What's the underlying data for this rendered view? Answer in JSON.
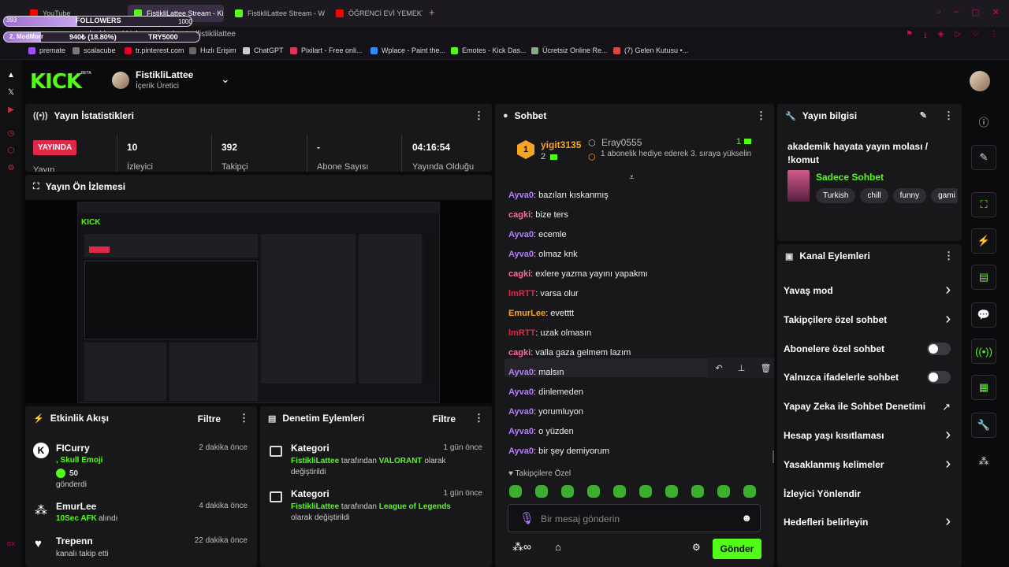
{
  "browser": {
    "tabs": [
      {
        "label": "YouTube",
        "color": "#ff0000"
      },
      {
        "label": "FistikliLattee Stream - Ki",
        "color": "#53fc18"
      },
      {
        "label": "FistikliLattee Stream - Wi",
        "color": "#53fc18"
      },
      {
        "label": "ÖĞRENCİ EVİ YEMEKTE",
        "color": "#ff0000"
      }
    ],
    "new_tab": "+",
    "url": "dashboard.kick.com/moderator/fistiklilattee",
    "bookmarks": [
      "premate",
      "scalacube",
      "tr.pinterest.com",
      "Hızlı Erişim",
      "ChatGPT",
      "Pixilart - Free onli...",
      "Wplace - Paint the...",
      "Emotes - Kick Das...",
      "Ücretsiz Online Re...",
      "(7) Gelen Kutusu •..."
    ]
  },
  "overlay": {
    "followers_count": "393",
    "followers_label": "FOLLOWERS",
    "followers_goal": "1000",
    "line2": "2. ModMorr",
    "money": "940₺ (18.80%)",
    "money_goal": "TRY5000"
  },
  "header": {
    "logo": "KICK",
    "logo_beta": "BETA",
    "channel_name": "FistikliLattee",
    "channel_role": "İçerik Üretici"
  },
  "stats": {
    "title": "Yayın İstatistikleri",
    "live_badge": "YAYINDA",
    "cols": [
      {
        "value": "10",
        "label": "İzleyici"
      },
      {
        "value": "392",
        "label": "Takipçi"
      },
      {
        "value": "-",
        "label": "Abone Sayısı"
      },
      {
        "value": "04:16:54",
        "label": "Yayında Olduğu"
      }
    ],
    "first_label": "Yayın"
  },
  "preview": {
    "title": "Yayın Ön İzlemesi"
  },
  "activity": {
    "title": "Etkinlik Akışı",
    "filter": "Filtre",
    "items": [
      {
        "user": "FICurry",
        "detail1": ", Skull Emoji",
        "amount": "50",
        "detail2": "gönderdi",
        "time": "2 dakika önce"
      },
      {
        "user": "EmurLee",
        "detail1": "10Sec AFK",
        "detail2": "alındı",
        "time": "4 dakika önce"
      },
      {
        "user": "Trepenn",
        "detail2": "kanalı takip etti",
        "time": "22 dakika önce"
      }
    ]
  },
  "moderation": {
    "title": "Denetim Eylemleri",
    "filter": "Filtre",
    "items": [
      {
        "title": "Kategori",
        "user": "FistikliLattee",
        "mid": " tarafından ",
        "cat": "VALORANT",
        "end": " olarak",
        "end2": "değiştirildi",
        "time": "1 gün önce"
      },
      {
        "title": "Kategori",
        "user": "FistikliLattee",
        "mid": " tarafından ",
        "cat": "League of Legends",
        "end": "",
        "end2": "olarak değiştirildi",
        "time": "1 gün önce"
      }
    ]
  },
  "chat": {
    "title": "Sohbet",
    "gifter_rank": "1",
    "gifter_name": "yigit3135",
    "gifter_count": "2",
    "sub_name": "Eray0555",
    "sub_count": "1",
    "sub_text": "1 abonelik hediye ederek 3. sıraya yükselin",
    "messages": [
      {
        "user": "Ayva0",
        "text": "bazıları kıskanmış",
        "color": "#b57cff"
      },
      {
        "user": "cagki",
        "text": "bize ters",
        "color": "#ff6b9a"
      },
      {
        "user": "Ayva0",
        "text": "ecemle",
        "color": "#b57cff"
      },
      {
        "user": "Ayva0",
        "text": "olmaz knk",
        "color": "#b57cff"
      },
      {
        "user": "cagki",
        "text": "exlere yazma yayını yapakmı",
        "color": "#ff6b9a"
      },
      {
        "user": "lmRTT",
        "text": "varsa olur",
        "color": "#e02849"
      },
      {
        "user": "EmurLee",
        "text": "evetttt",
        "color": "#f5a524"
      },
      {
        "user": "lmRTT",
        "text": "uzak olmasın",
        "color": "#e02849"
      },
      {
        "user": "cagki",
        "text": "valla gaza gelmem lazım",
        "color": "#ff6b9a"
      },
      {
        "user": "Ayva0",
        "text": "malsın",
        "color": "#b57cff"
      },
      {
        "user": "Ayva0",
        "text": "dinlemeden",
        "color": "#b57cff"
      },
      {
        "user": "Ayva0",
        "text": "yorumluyon",
        "color": "#b57cff"
      },
      {
        "user": "Ayva0",
        "text": "o yüzden",
        "color": "#b57cff"
      },
      {
        "user": "Ayva0",
        "text": "bir şey demiyorum",
        "color": "#b57cff"
      }
    ],
    "follower_only": "Takipçilere Özel",
    "placeholder": "Bir mesaj gönderin",
    "send": "Gönder"
  },
  "info": {
    "title": "Yayın bilgisi",
    "stream_title": "akademik hayata yayın molası / !komut",
    "category": "Sadece Sohbet",
    "tags": [
      "Turkish",
      "chill",
      "funny",
      "gami"
    ]
  },
  "channel_actions": {
    "title": "Kanal Eylemleri",
    "items": [
      {
        "label": "Yavaş mod",
        "ctl": "chevron"
      },
      {
        "label": "Takipçilere özel sohbet",
        "ctl": "chevron"
      },
      {
        "label": "Abonelere özel sohbet",
        "ctl": "toggle"
      },
      {
        "label": "Yalnızca ifadelerle sohbet",
        "ctl": "toggle"
      },
      {
        "label": "Yapay Zeka ile Sohbet Denetimi",
        "ctl": "external"
      },
      {
        "label": "Hesap yaşı kısıtlaması",
        "ctl": "chevron"
      },
      {
        "label": "Yasaklanmış kelimeler",
        "ctl": "chevron"
      },
      {
        "label": "İzleyici Yönlendir",
        "ctl": "none"
      },
      {
        "label": "Hedefleri belirleyin",
        "ctl": "chevron"
      }
    ]
  }
}
